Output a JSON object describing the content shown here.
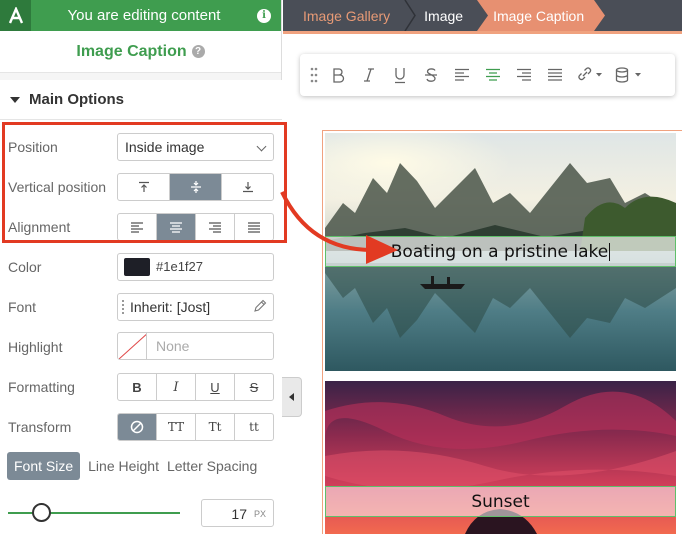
{
  "header": {
    "title": "You are editing content",
    "logo_letter": "A"
  },
  "panel": {
    "title": "Image Caption"
  },
  "section": {
    "title": "Main Options"
  },
  "fields": {
    "position": {
      "label": "Position",
      "value": "Inside image"
    },
    "vertical_position": {
      "label": "Vertical position"
    },
    "alignment": {
      "label": "Alignment"
    },
    "color": {
      "label": "Color",
      "value": "#1e1f27"
    },
    "font": {
      "label": "Font",
      "value": "Inherit: [Jost]"
    },
    "highlight": {
      "label": "Highlight",
      "placeholder": "None"
    },
    "formatting": {
      "label": "Formatting",
      "bold": "B",
      "italic": "I",
      "underline": "U",
      "strike": "S"
    },
    "transform": {
      "label": "Transform",
      "upper": "TT",
      "title": "Tt",
      "lower": "tt"
    }
  },
  "typo_tabs": {
    "font_size": "Font Size",
    "line_height": "Line Height",
    "letter_spacing": "Letter Spacing"
  },
  "font_size": {
    "value": "17",
    "unit": "PX"
  },
  "breadcrumbs": [
    "Image Gallery",
    "Image",
    "Image Caption"
  ],
  "captions": {
    "first": "Boating on a pristine lake",
    "second": "Sunset"
  },
  "colors": {
    "accent": "#3f9d4f",
    "highlight_box": "#e23a22",
    "breadcrumb_active": "#e79071"
  }
}
